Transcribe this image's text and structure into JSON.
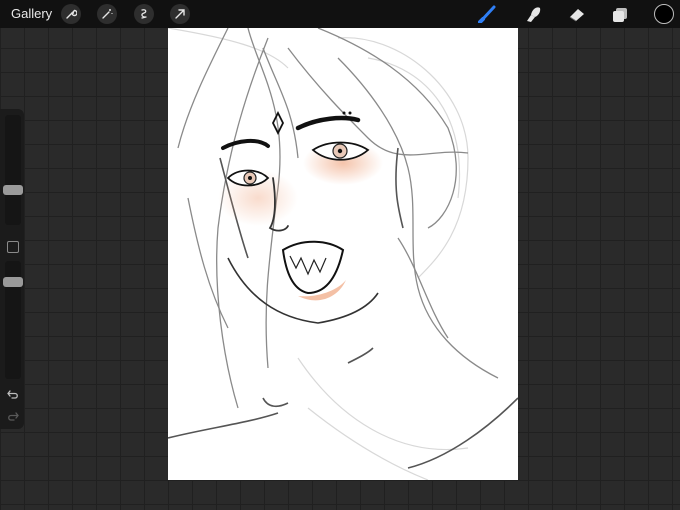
{
  "toolbar": {
    "gallery_label": "Gallery",
    "left_tools": [
      "wrench-icon",
      "magic-wand-icon",
      "selection-icon",
      "transform-arrow-icon"
    ],
    "right_tools": [
      "brush-icon",
      "smudge-icon",
      "eraser-icon",
      "layers-icon"
    ],
    "active_tool": "brush-icon",
    "accent_color": "#2f7ff5",
    "current_color": "#000000"
  },
  "sidebar": {
    "brush_size_level": 0.3,
    "opacity_level": 0.25
  },
  "canvas": {
    "background": "#ffffff",
    "artwork": "sketch-of-face"
  }
}
